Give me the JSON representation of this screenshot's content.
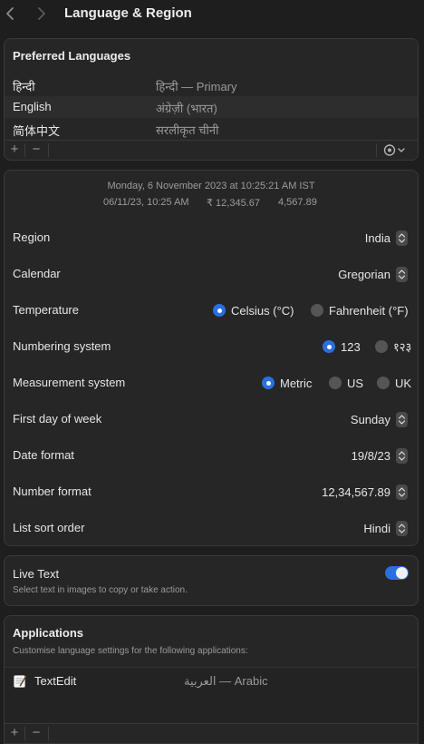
{
  "window": {
    "title": "Language & Region"
  },
  "preferred_languages": {
    "heading": "Preferred Languages",
    "items": [
      {
        "name": "हिन्दी",
        "native": "हिन्दी — Primary"
      },
      {
        "name": "English",
        "native": "अंग्रेज़ी (भारत)"
      },
      {
        "name": "简体中文",
        "native": "सरलीकृत चीनी"
      }
    ],
    "add_label": "+",
    "remove_label": "−"
  },
  "preview": {
    "line1": "Monday, 6 November 2023 at 10:25:21 AM IST",
    "date_short": "06/11/23, 10:25 AM",
    "currency": "₹ 12,345.67",
    "number": "4,567.89"
  },
  "settings": {
    "region": {
      "label": "Region",
      "value": "India"
    },
    "calendar": {
      "label": "Calendar",
      "value": "Gregorian"
    },
    "temperature": {
      "label": "Temperature",
      "options": [
        "Celsius (°C)",
        "Fahrenheit (°F)"
      ],
      "selected": "Celsius (°C)"
    },
    "numbering": {
      "label": "Numbering system",
      "options": [
        "123",
        "१२३"
      ],
      "selected": "123"
    },
    "measurement": {
      "label": "Measurement system",
      "options": [
        "Metric",
        "US",
        "UK"
      ],
      "selected": "Metric"
    },
    "first_day": {
      "label": "First day of week",
      "value": "Sunday"
    },
    "date_format": {
      "label": "Date format",
      "value": "19/8/23"
    },
    "number_format": {
      "label": "Number format",
      "value": "12,34,567.89"
    },
    "list_sort": {
      "label": "List sort order",
      "value": "Hindi"
    }
  },
  "live_text": {
    "title": "Live Text",
    "subtitle": "Select text in images to copy or take action.",
    "enabled": true
  },
  "applications": {
    "heading": "Applications",
    "subtitle": "Customise language settings for the following applications:",
    "items": [
      {
        "name": "TextEdit",
        "language": "العربية — Arabic"
      }
    ],
    "add_label": "+",
    "remove_label": "−"
  },
  "colors": {
    "accent": "#2a6fe0",
    "background": "#1e1e1e",
    "panel": "#262626"
  }
}
